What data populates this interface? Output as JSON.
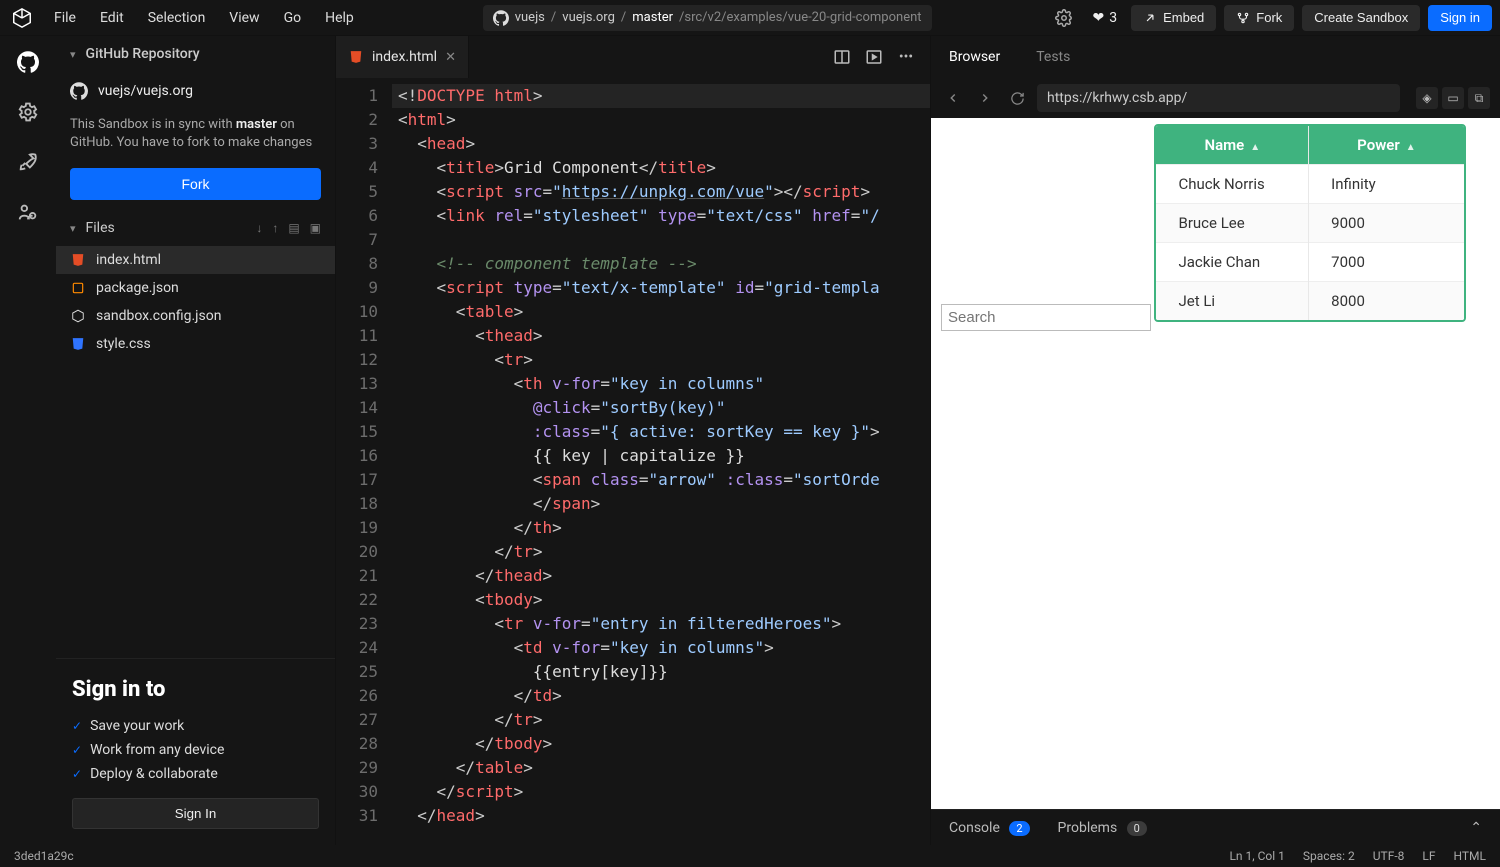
{
  "menu": {
    "file": "File",
    "edit": "Edit",
    "selection": "Selection",
    "view": "View",
    "go": "Go",
    "help": "Help"
  },
  "breadcrumb": {
    "org": "vuejs",
    "repo": "vuejs.org",
    "branch": "master",
    "path": "/src/v2/examples/vue-20-grid-component"
  },
  "top": {
    "likes": "3",
    "embed": "Embed",
    "fork": "Fork",
    "create": "Create Sandbox",
    "signin": "Sign in"
  },
  "sidebar": {
    "header": "GitHub Repository",
    "repo_full": "vuejs/vuejs.org",
    "sync_pre": "This Sandbox is in sync with ",
    "sync_branch": "master",
    "sync_post": " on GitHub. You have to fork to make changes",
    "fork": "Fork",
    "files_label": "Files",
    "files": [
      "index.html",
      "package.json",
      "sandbox.config.json",
      "style.css"
    ],
    "signin_title": "Sign in to",
    "benefits": [
      "Save your work",
      "Work from any device",
      "Deploy & collaborate"
    ],
    "signin_btn": "Sign In"
  },
  "tabs": {
    "active": "index.html"
  },
  "code": {
    "lines": [
      {
        "n": 1,
        "html": "<span class='p'>&lt;!</span><span class='doctype'>DOCTYPE html</span><span class='p'>&gt;</span>"
      },
      {
        "n": 2,
        "html": "<span class='p'>&lt;</span><span class='t'>html</span><span class='p'>&gt;</span>"
      },
      {
        "n": 3,
        "html": "  <span class='p'>&lt;</span><span class='t'>head</span><span class='p'>&gt;</span>"
      },
      {
        "n": 4,
        "html": "    <span class='p'>&lt;</span><span class='t'>title</span><span class='p'>&gt;</span><span class='tx'>Grid Component</span><span class='p'>&lt;/</span><span class='t'>title</span><span class='p'>&gt;</span>"
      },
      {
        "n": 5,
        "html": "    <span class='p'>&lt;</span><span class='t'>script</span> <span class='an'>src</span><span class='p'>=</span><span class='av'>&quot;<span class='url'>https://unpkg.com/vue</span>&quot;</span><span class='p'>&gt;&lt;/</span><span class='t'>script</span><span class='p'>&gt;</span>"
      },
      {
        "n": 6,
        "html": "    <span class='p'>&lt;</span><span class='t'>link</span> <span class='an'>rel</span><span class='p'>=</span><span class='av'>&quot;stylesheet&quot;</span> <span class='an'>type</span><span class='p'>=</span><span class='av'>&quot;text/css&quot;</span> <span class='an'>href</span><span class='p'>=</span><span class='av'>&quot;/</span>"
      },
      {
        "n": 7,
        "html": ""
      },
      {
        "n": 8,
        "html": "    <span class='cm'>&lt;!-- component template --&gt;</span>"
      },
      {
        "n": 9,
        "html": "    <span class='p'>&lt;</span><span class='t'>script</span> <span class='an'>type</span><span class='p'>=</span><span class='av'>&quot;text/x-template&quot;</span> <span class='an'>id</span><span class='p'>=</span><span class='av'>&quot;grid-templa</span>"
      },
      {
        "n": 10,
        "html": "      <span class='p'>&lt;</span><span class='t'>table</span><span class='p'>&gt;</span>"
      },
      {
        "n": 11,
        "html": "        <span class='p'>&lt;</span><span class='t'>thead</span><span class='p'>&gt;</span>"
      },
      {
        "n": 12,
        "html": "          <span class='p'>&lt;</span><span class='t'>tr</span><span class='p'>&gt;</span>"
      },
      {
        "n": 13,
        "html": "            <span class='p'>&lt;</span><span class='t'>th</span> <span class='an'>v-for</span><span class='p'>=</span><span class='av'>&quot;key in columns&quot;</span>"
      },
      {
        "n": 14,
        "html": "              <span class='an'>@click</span><span class='p'>=</span><span class='av'>&quot;sortBy(key)&quot;</span>"
      },
      {
        "n": 15,
        "html": "              <span class='an'>:class</span><span class='p'>=</span><span class='av'>&quot;{ active: sortKey == key }&quot;</span><span class='p'>&gt;</span>"
      },
      {
        "n": 16,
        "html": "              <span class='tx'>{{ key | capitalize }}</span>"
      },
      {
        "n": 17,
        "html": "              <span class='p'>&lt;</span><span class='t'>span</span> <span class='an'>class</span><span class='p'>=</span><span class='av'>&quot;arrow&quot;</span> <span class='an'>:class</span><span class='p'>=</span><span class='av'>&quot;sortOrde</span>"
      },
      {
        "n": 18,
        "html": "              <span class='p'>&lt;/</span><span class='t'>span</span><span class='p'>&gt;</span>"
      },
      {
        "n": 19,
        "html": "            <span class='p'>&lt;/</span><span class='t'>th</span><span class='p'>&gt;</span>"
      },
      {
        "n": 20,
        "html": "          <span class='p'>&lt;/</span><span class='t'>tr</span><span class='p'>&gt;</span>"
      },
      {
        "n": 21,
        "html": "        <span class='p'>&lt;/</span><span class='t'>thead</span><span class='p'>&gt;</span>"
      },
      {
        "n": 22,
        "html": "        <span class='p'>&lt;</span><span class='t'>tbody</span><span class='p'>&gt;</span>"
      },
      {
        "n": 23,
        "html": "          <span class='p'>&lt;</span><span class='t'>tr</span> <span class='an'>v-for</span><span class='p'>=</span><span class='av'>&quot;entry in filteredHeroes&quot;</span><span class='p'>&gt;</span>"
      },
      {
        "n": 24,
        "html": "            <span class='p'>&lt;</span><span class='t'>td</span> <span class='an'>v-for</span><span class='p'>=</span><span class='av'>&quot;key in columns&quot;</span><span class='p'>&gt;</span>"
      },
      {
        "n": 25,
        "html": "              <span class='tx'>{{entry[key]}}</span>"
      },
      {
        "n": 26,
        "html": "            <span class='p'>&lt;/</span><span class='t'>td</span><span class='p'>&gt;</span>"
      },
      {
        "n": 27,
        "html": "          <span class='p'>&lt;/</span><span class='t'>tr</span><span class='p'>&gt;</span>"
      },
      {
        "n": 28,
        "html": "        <span class='p'>&lt;/</span><span class='t'>tbody</span><span class='p'>&gt;</span>"
      },
      {
        "n": 29,
        "html": "      <span class='p'>&lt;/</span><span class='t'>table</span><span class='p'>&gt;</span>"
      },
      {
        "n": 30,
        "html": "    <span class='p'>&lt;/</span><span class='t'>script</span><span class='p'>&gt;</span>"
      },
      {
        "n": 31,
        "html": "  <span class='p'>&lt;/</span><span class='t'>head</span><span class='p'>&gt;</span>"
      }
    ]
  },
  "preview": {
    "tabs": {
      "browser": "Browser",
      "tests": "Tests"
    },
    "url": "https://krhwy.csb.app/",
    "search_placeholder": "Search",
    "headers": [
      "Name",
      "Power"
    ],
    "rows": [
      {
        "name": "Chuck Norris",
        "power": "Infinity"
      },
      {
        "name": "Bruce Lee",
        "power": "9000"
      },
      {
        "name": "Jackie Chan",
        "power": "7000"
      },
      {
        "name": "Jet Li",
        "power": "8000"
      }
    ],
    "bottom": {
      "console": "Console",
      "console_n": "2",
      "problems": "Problems",
      "problems_n": "0"
    }
  },
  "status": {
    "sha": "3ded1a29c",
    "cursor": "Ln 1, Col 1",
    "spaces": "Spaces: 2",
    "encoding": "UTF-8",
    "eol": "LF",
    "lang": "HTML"
  }
}
